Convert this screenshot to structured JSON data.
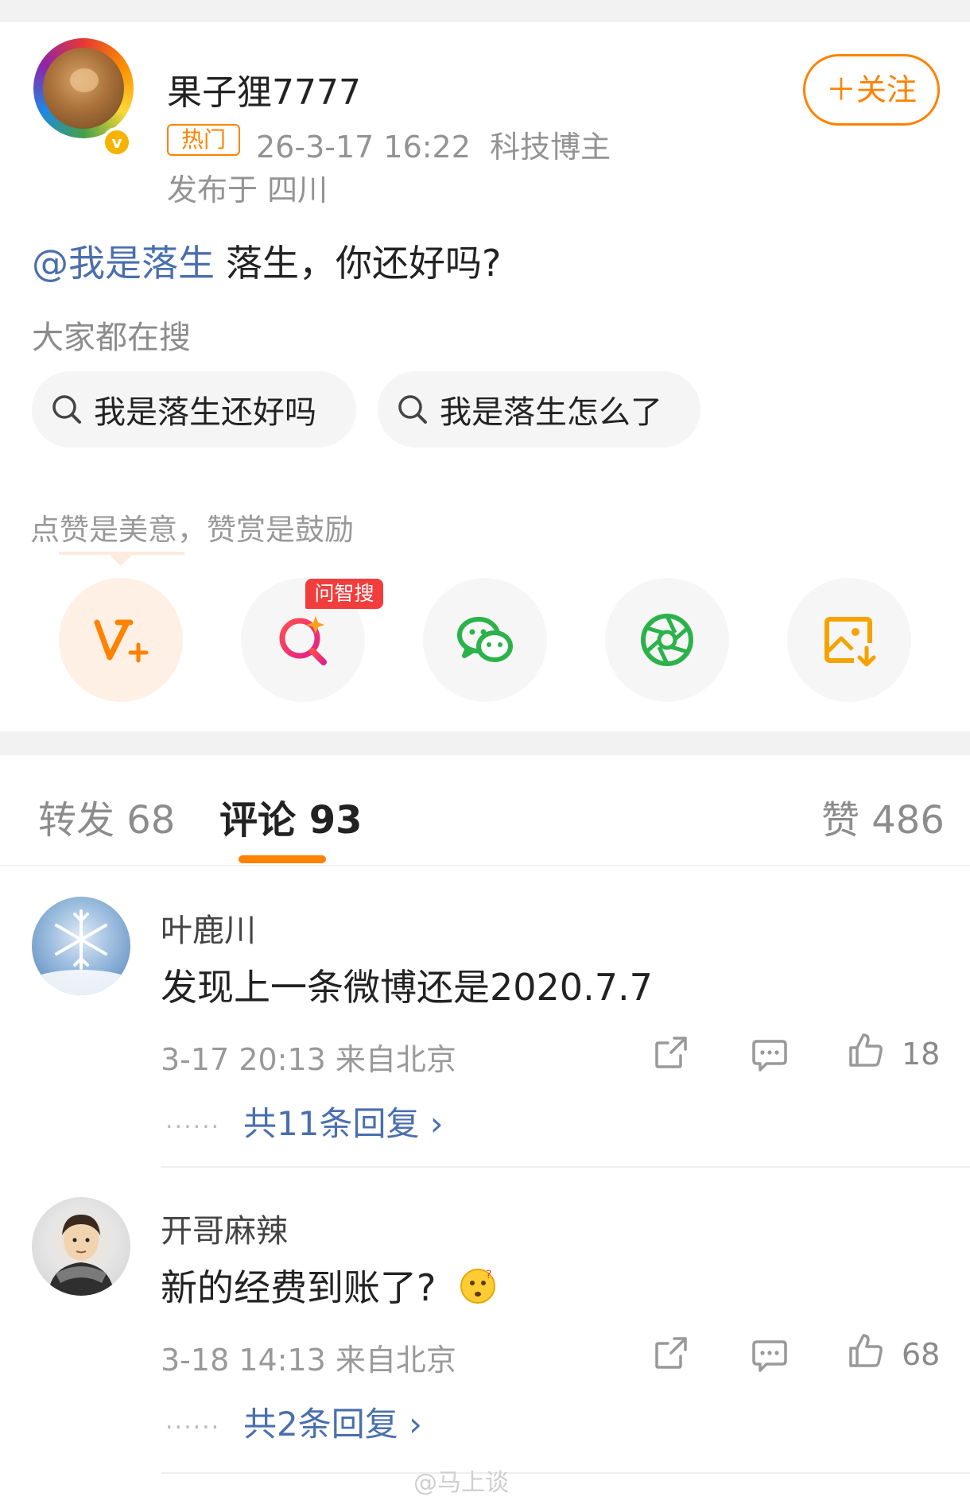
{
  "post": {
    "author": "果子狸7777",
    "verified_badge": "v",
    "hot_badge": "热门",
    "timestamp": "26-3-17 16:22",
    "category": "科技博主",
    "location": "发布于 四川",
    "follow_label": "＋关注",
    "mention": "@我是落生",
    "text": "落生，你还好吗?",
    "search_label": "大家都在搜",
    "search_chips": [
      "我是落生还好吗",
      "我是落生怎么了"
    ],
    "tip_text": "点赞是美意，赞赏是鼓励",
    "ai_badge": "问智搜",
    "share_icons": [
      "tip-v-plus-icon",
      "ai-search-icon",
      "wechat-icon",
      "moments-icon",
      "save-image-icon"
    ]
  },
  "tabs": {
    "repost": "转发 68",
    "comments": "评论 93",
    "likes": "赞 486"
  },
  "comments": [
    {
      "name": "叶鹿川",
      "text": "发现上一条微博还是2020.7.7",
      "meta": "3-17 20:13 来自北京",
      "likes": "18",
      "replies_dots": "......",
      "replies": "共11条回复 ›"
    },
    {
      "name": "开哥麻辣",
      "text": "新的经费到账了?",
      "meta": "3-18 14:13 来自北京",
      "likes": "68",
      "replies_dots": "......",
      "replies": "共2条回复 ›"
    }
  ],
  "watermark": "@马上谈",
  "colors": {
    "accent": "#ff8200",
    "link": "#4a6fae",
    "muted": "#939393"
  }
}
